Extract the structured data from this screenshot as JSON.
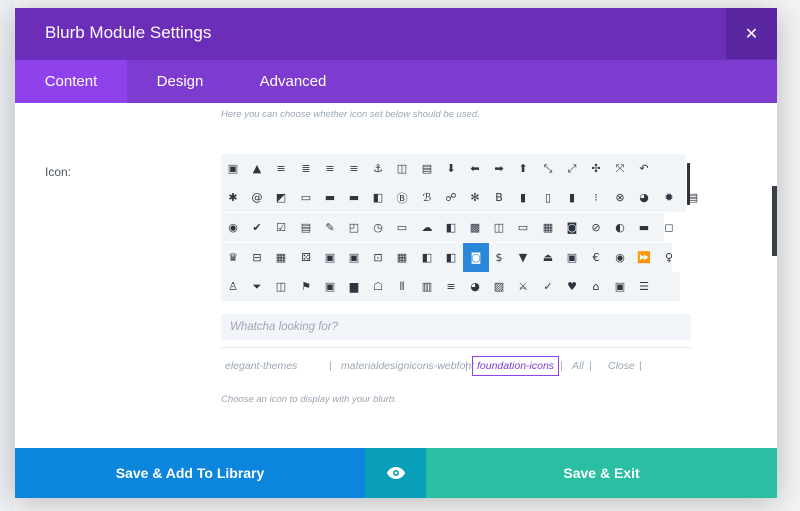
{
  "modal": {
    "title": "Blurb Module Settings",
    "close_glyph": "✕"
  },
  "tabs": [
    {
      "label": "Content",
      "active": true
    },
    {
      "label": "Design",
      "active": false
    },
    {
      "label": "Advanced",
      "active": false
    }
  ],
  "content": {
    "help_top": "Here you can choose whether icon set below should be used.",
    "icon_label": "Icon:",
    "search_placeholder": "Whatcha looking for?",
    "help_bottom": "Choose an icon to display with your blurb."
  },
  "icon_rows": [
    [
      "▣",
      "▲",
      "≡",
      "≣",
      "≡",
      "≡",
      "⚓",
      "◫",
      "▤",
      "⬇",
      "⬅",
      "➡",
      "⬆",
      "⤡",
      "⤢",
      "✣",
      "⤧",
      "↶"
    ],
    [
      "✱",
      "@",
      "◩",
      "▭",
      "▬",
      "▬",
      "◧",
      "Ⓑ",
      "ℬ",
      "☍",
      "✻",
      "B",
      "▮",
      "▯",
      "▮",
      "⁝",
      "⊗",
      "◕",
      "✹",
      "▤"
    ],
    [
      "◉",
      "✔",
      "☑",
      "▤",
      "✎",
      "◰",
      "◷",
      "▭",
      "☁",
      "◧",
      "▩",
      "◫",
      "▭",
      "▦",
      "◙",
      "⊘",
      "◐",
      "▬",
      "◻"
    ],
    [
      "♛",
      "⊟",
      "▦",
      "⚄",
      "▣",
      "▣",
      "⊡",
      "▦",
      "◧",
      "◧",
      "◙",
      "$",
      "▼",
      "⏏",
      "▣",
      "€",
      "◉",
      "⏩",
      "♀"
    ],
    [
      "♙",
      "⏷",
      "◫",
      "⚑",
      "▣",
      "▆",
      "☖",
      "⫴",
      "▥",
      "≡",
      "◕",
      "▨",
      "⚔",
      "✓",
      "♥",
      "⌂",
      "▣",
      "☰"
    ]
  ],
  "selected_icon": {
    "row": 3,
    "col": 10,
    "glyph": "▣",
    "name": "selected-icon"
  },
  "filters": [
    "elegant-themes",
    "materialdesignicons-webfont",
    "foundation-icons",
    "All",
    "Close"
  ],
  "active_filter": "foundation-icons",
  "footer": {
    "save_library": "Save & Add To Library",
    "preview_glyph": "◉",
    "save_exit": "Save & Exit"
  },
  "colors": {
    "header": "#6c2eb9",
    "tabs": "#7e3bd0",
    "tab_active": "#8f42ec",
    "save_library": "#0c86dc",
    "preview": "#0a9fb8",
    "save_exit": "#2abfa2",
    "selected": "#2b87da"
  }
}
